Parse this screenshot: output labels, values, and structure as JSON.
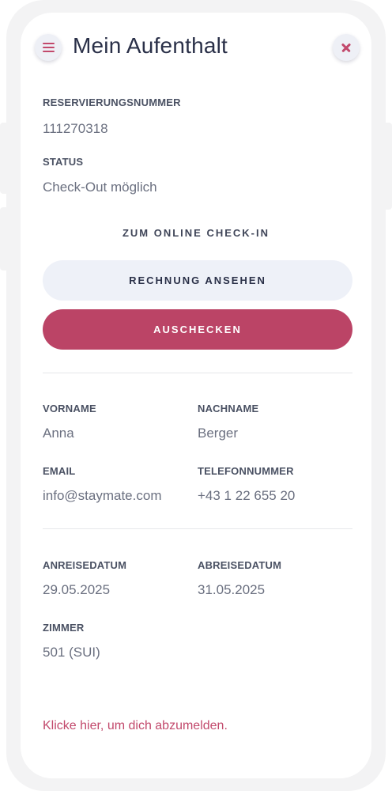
{
  "header": {
    "title": "Mein Aufenthalt",
    "menu_icon": "hamburger-menu-icon",
    "close_icon": "close-icon"
  },
  "reservation": {
    "number_label": "RESERVIERUNGSNUMMER",
    "number_value": "111270318",
    "status_label": "STATUS",
    "status_value": "Check-Out möglich"
  },
  "actions": {
    "online_checkin_label": "ZUM ONLINE CHECK-IN",
    "invoice_label": "RECHNUNG ANSEHEN",
    "checkout_label": "AUSCHECKEN"
  },
  "guest": {
    "firstname_label": "VORNAME",
    "firstname_value": "Anna",
    "lastname_label": "NACHNAME",
    "lastname_value": "Berger",
    "email_label": "EMAIL",
    "email_value": "info@staymate.com",
    "phone_label": "TELEFONNUMMER",
    "phone_value": "+43 1 22 655 20"
  },
  "stay": {
    "arrival_label": "ANREISEDATUM",
    "arrival_value": "29.05.2025",
    "departure_label": "ABREISEDATUM",
    "departure_value": "31.05.2025",
    "room_label": "ZIMMER",
    "room_value": "501 (SUI)"
  },
  "footer": {
    "logout_text": "Klicke hier, um dich abzumelden."
  },
  "colors": {
    "accent": "#bb4466",
    "button_light": "#eef1f8",
    "title_text": "#2a3048"
  }
}
